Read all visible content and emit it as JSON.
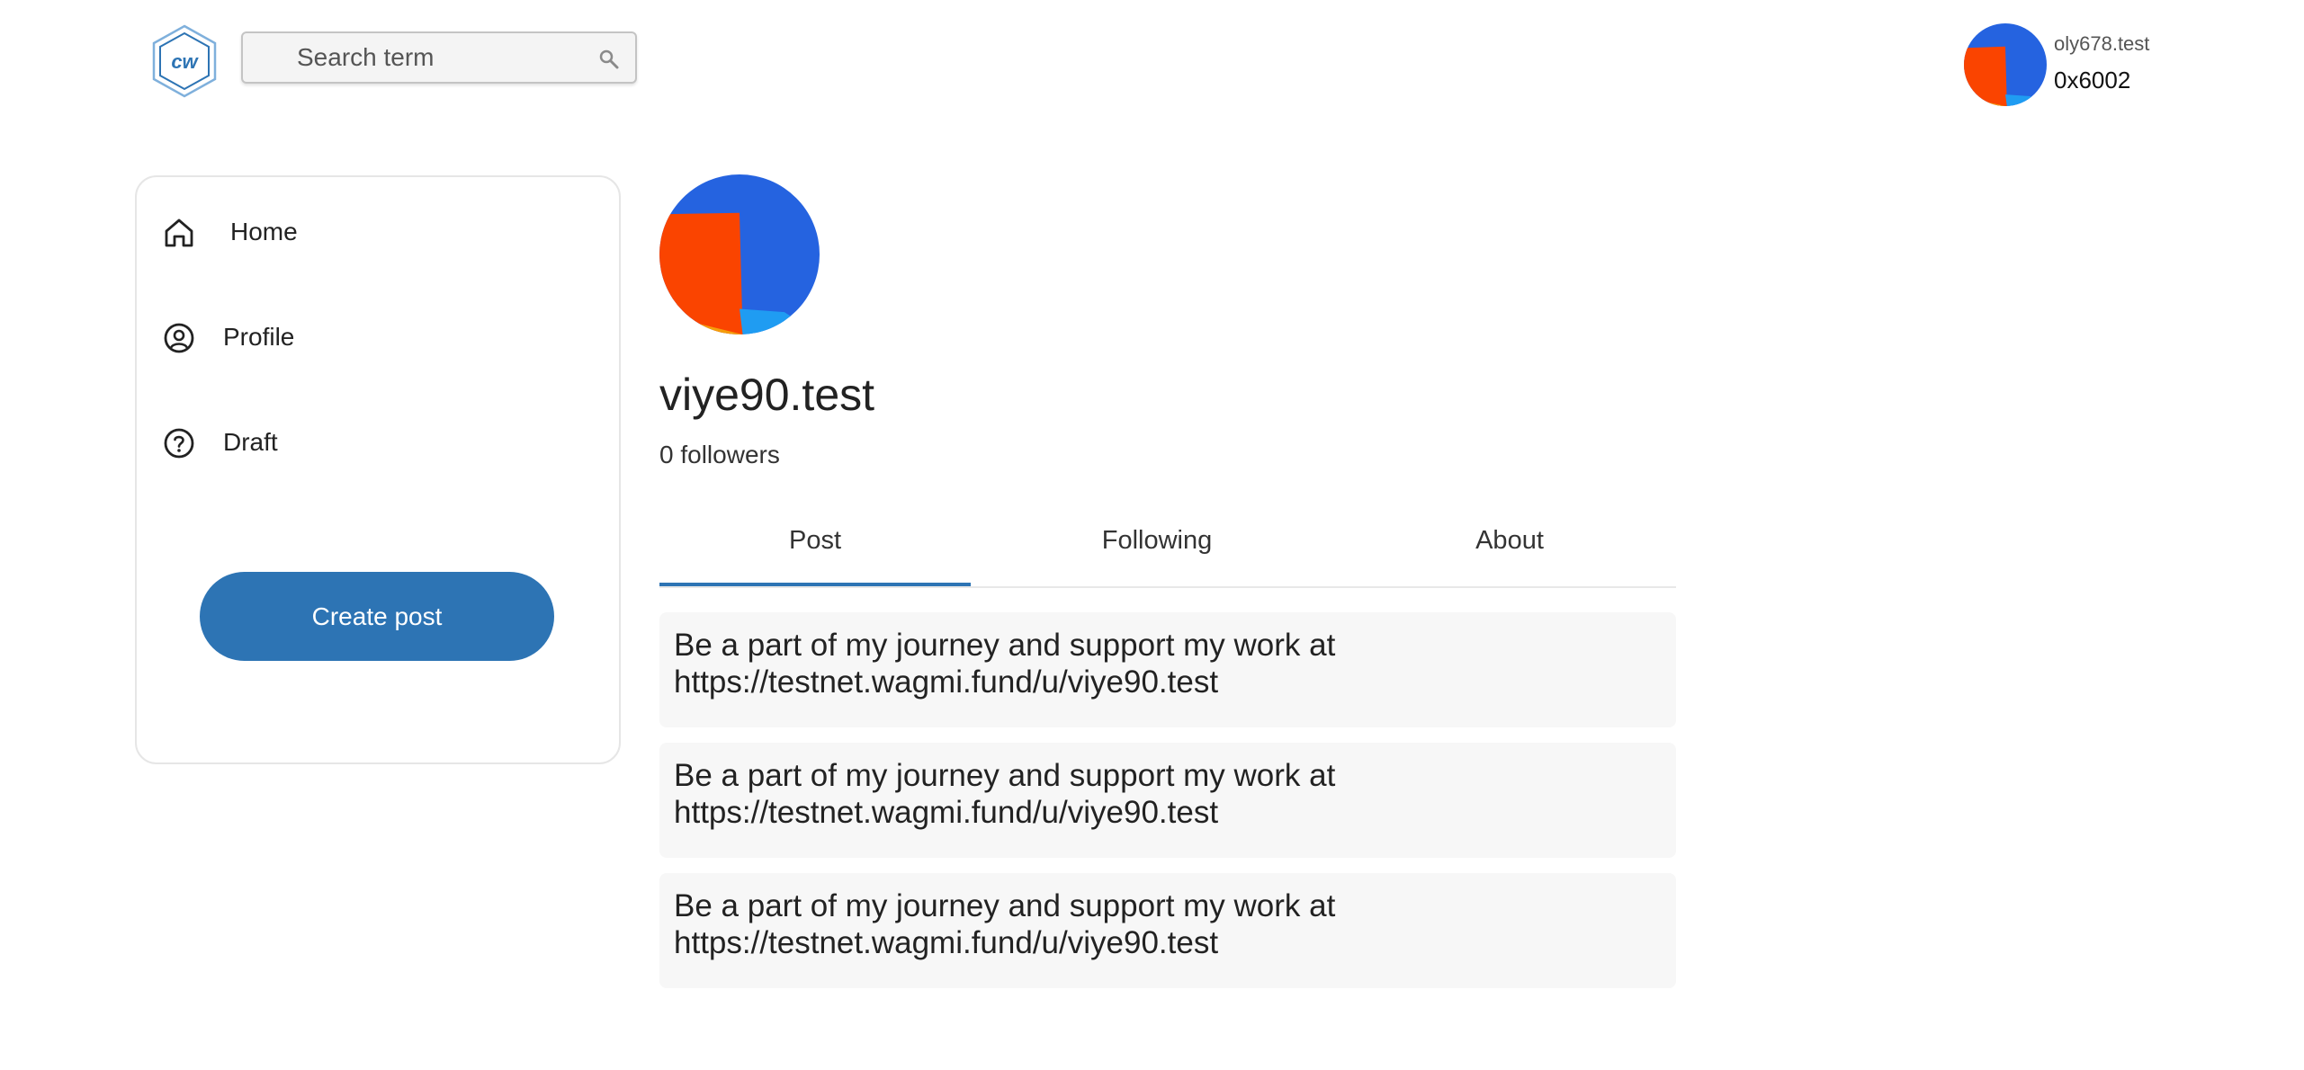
{
  "header": {
    "logo_text": "cw",
    "search": {
      "placeholder": "Search term",
      "value": ""
    },
    "current_user": {
      "name": "oly678.test",
      "address": "0x6002"
    }
  },
  "sidebar": {
    "items": [
      {
        "label": "Home",
        "icon": "home-icon"
      },
      {
        "label": "Profile",
        "icon": "user-circle-icon"
      },
      {
        "label": "Draft",
        "icon": "question-circle-icon"
      }
    ],
    "create_post_label": "Create post"
  },
  "profile": {
    "name": "viye90.test",
    "followers": "0 followers"
  },
  "tabs": [
    {
      "label": "Post",
      "active": true
    },
    {
      "label": "Following",
      "active": false
    },
    {
      "label": "About",
      "active": false
    }
  ],
  "posts": [
    {
      "line1": "Be a part of my journey and support my work at",
      "line2": "https://testnet.wagmi.fund/u/viye90.test"
    },
    {
      "line1": "Be a part of my journey and support my work at",
      "line2": "https://testnet.wagmi.fund/u/viye90.test"
    },
    {
      "line1": "Be a part of my journey and support my work at",
      "line2": "https://testnet.wagmi.fund/u/viye90.test"
    }
  ],
  "colors": {
    "accent": "#2d74b4",
    "avatar_blue": "#2563e0",
    "avatar_orange": "#fa4400",
    "avatar_light_blue": "#1f9cf2",
    "card_background": "#f7f7f7"
  }
}
